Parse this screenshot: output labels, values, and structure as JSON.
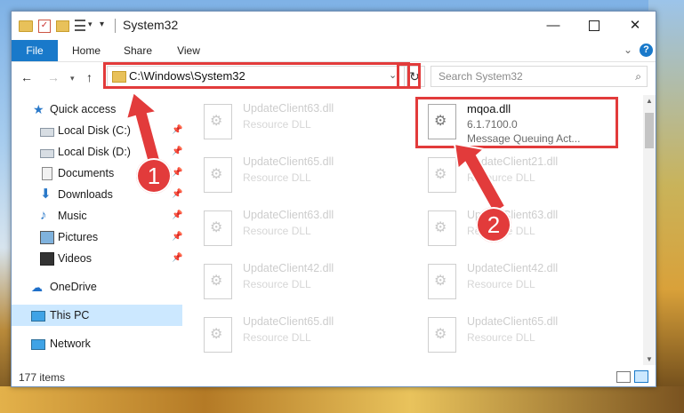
{
  "window": {
    "title": "System32",
    "controls": {
      "minimize": "—",
      "maximize": "",
      "close": "✕"
    }
  },
  "ribbon": {
    "tabs": [
      "File",
      "Home",
      "Share",
      "View"
    ],
    "help": "?",
    "chevron": "⌄"
  },
  "nav": {
    "back": "←",
    "forward": "→",
    "recent": "▾",
    "up": "↑",
    "address": "C:\\Windows\\System32",
    "address_dropdown": "⌄",
    "refresh": "↻",
    "search_placeholder": "Search System32",
    "search_icon": "⌕"
  },
  "sidebar": {
    "items": [
      {
        "label": "Quick access",
        "icon": "star-icon",
        "pinned": false
      },
      {
        "label": "Local Disk (C:)",
        "icon": "disk-icon",
        "pinned": true
      },
      {
        "label": "Local Disk (D:)",
        "icon": "disk-icon",
        "pinned": true
      },
      {
        "label": "Documents",
        "icon": "documents-icon",
        "pinned": true
      },
      {
        "label": "Downloads",
        "icon": "download-icon",
        "pinned": true
      },
      {
        "label": "Music",
        "icon": "music-icon",
        "pinned": true
      },
      {
        "label": "Pictures",
        "icon": "pictures-icon",
        "pinned": true
      },
      {
        "label": "Videos",
        "icon": "videos-icon",
        "pinned": true
      },
      {
        "label": "OneDrive",
        "icon": "cloud-icon",
        "pinned": false
      },
      {
        "label": "This PC",
        "icon": "computer-icon",
        "pinned": false,
        "selected": true
      },
      {
        "label": "Network",
        "icon": "network-icon",
        "pinned": false
      }
    ],
    "pin_glyph": "📌"
  },
  "files": {
    "left_column": [
      {
        "name": "UpdateClient63.dll",
        "desc": "Resource DLL"
      },
      {
        "name": "UpdateClient65.dll",
        "desc": "Resource DLL"
      },
      {
        "name": "UpdateClient63.dll",
        "desc": "Resource DLL"
      },
      {
        "name": "UpdateClient42.dll",
        "desc": "Resource DLL"
      },
      {
        "name": "UpdateClient65.dll",
        "desc": "Resource DLL"
      }
    ],
    "highlighted": {
      "name": "mqoa.dll",
      "version": "6.1.7100.0",
      "desc": "Message Queuing Act..."
    },
    "right_column": [
      {
        "name": "UpdateClient21.dll",
        "desc": "Resource DLL"
      },
      {
        "name": "UpdateClient63.dll",
        "desc": "Resource DLL"
      },
      {
        "name": "UpdateClient42.dll",
        "desc": "Resource DLL"
      },
      {
        "name": "UpdateClient65.dll",
        "desc": "Resource DLL"
      }
    ]
  },
  "status": {
    "item_count": "177 items"
  },
  "callouts": {
    "one": "1",
    "two": "2"
  },
  "colors": {
    "accent": "#1979ca",
    "highlight": "#e23b3b",
    "selected_bg": "#cce8ff"
  }
}
